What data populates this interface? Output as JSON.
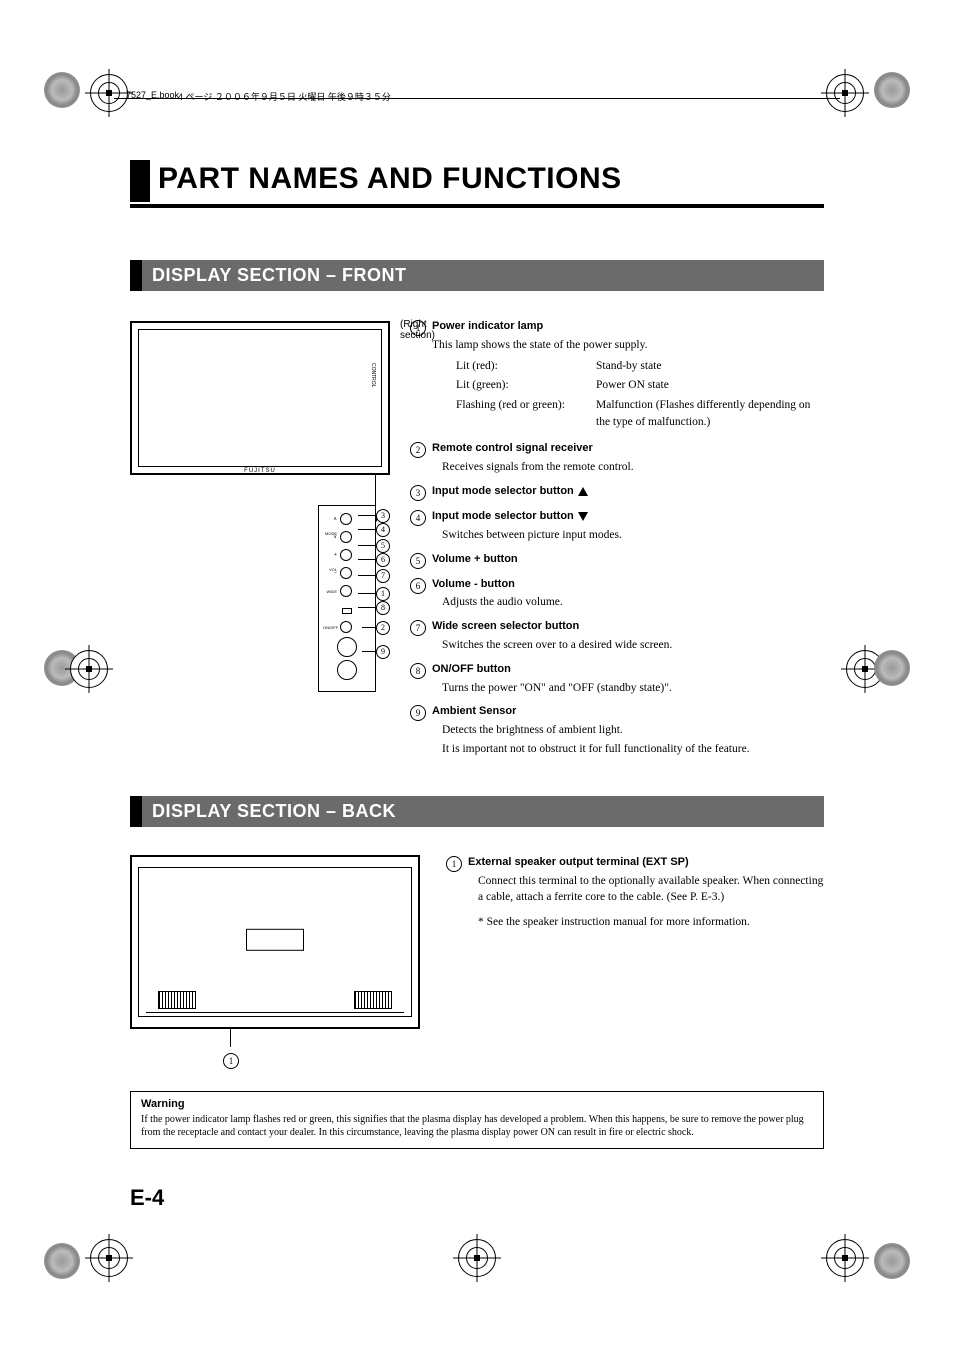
{
  "header": {
    "file": "7527_E.book",
    "page_info": " 4 ページ ２００６年９月５日 火曜日 午後９時３５分"
  },
  "title": "PART NAMES AND FUNCTIONS",
  "section_front": "DISPLAY SECTION – FRONT",
  "section_back": "DISPLAY SECTION – BACK",
  "right_section": "(Right section)",
  "display_brand": "FUJITSU",
  "side_label": "CONTROL",
  "front_items": [
    {
      "n": "1",
      "title": "Power indicator lamp",
      "desc": "This lamp shows the state of the power supply.",
      "states": [
        {
          "k": "Lit (red):",
          "v": "Stand-by state"
        },
        {
          "k": "Lit (green):",
          "v": "Power ON state"
        },
        {
          "k": "Flashing (red or green):",
          "v": "Malfunction (Flashes differently depending on the type of malfunction.)"
        }
      ]
    },
    {
      "n": "2",
      "title": "Remote control signal receiver",
      "desc": "Receives signals from the remote control."
    },
    {
      "n": "3",
      "title": "Input mode selector button",
      "tri": "up"
    },
    {
      "n": "4",
      "title": "Input mode selector button",
      "tri": "down",
      "desc": "Switches between picture input modes."
    },
    {
      "n": "5",
      "title": "Volume + button"
    },
    {
      "n": "6",
      "title": "Volume - button",
      "desc": "Adjusts the audio volume."
    },
    {
      "n": "7",
      "title": "Wide screen selector button",
      "desc": "Switches the screen over to a desired wide screen."
    },
    {
      "n": "8",
      "title": "ON/OFF button",
      "desc": "Turns the power \"ON\" and \"OFF (standby state)\"."
    },
    {
      "n": "9",
      "title": "Ambient Sensor",
      "desc": "Detects the brightness of ambient light.",
      "desc2": "It is important not to obstruct it for full functionality of the feature."
    }
  ],
  "ctrl_labels": {
    "mode_up": "∧",
    "mode_dn": "∨",
    "mode": "MODE",
    "vol_plus": "+",
    "vol_minus": "−",
    "vol": "VOL",
    "wide": "WIDE",
    "onoff": "ON/OFF"
  },
  "back_items": [
    {
      "n": "1",
      "title": "External speaker output terminal (EXT SP)",
      "desc": "Connect this terminal to the optionally available speaker. When connecting a cable, attach a ferrite core to the cable. (See P. E-3.)",
      "desc2": "* See the speaker instruction manual for more information."
    }
  ],
  "warning": {
    "title": "Warning",
    "text": "If the power indicator lamp flashes red or green, this signifies that the plasma display has developed a problem. When this happens, be sure to remove the power plug from the receptacle and contact your dealer. In this circumstance, leaving the plasma display power ON can result in fire or electric shock."
  },
  "page_number": "E-4"
}
